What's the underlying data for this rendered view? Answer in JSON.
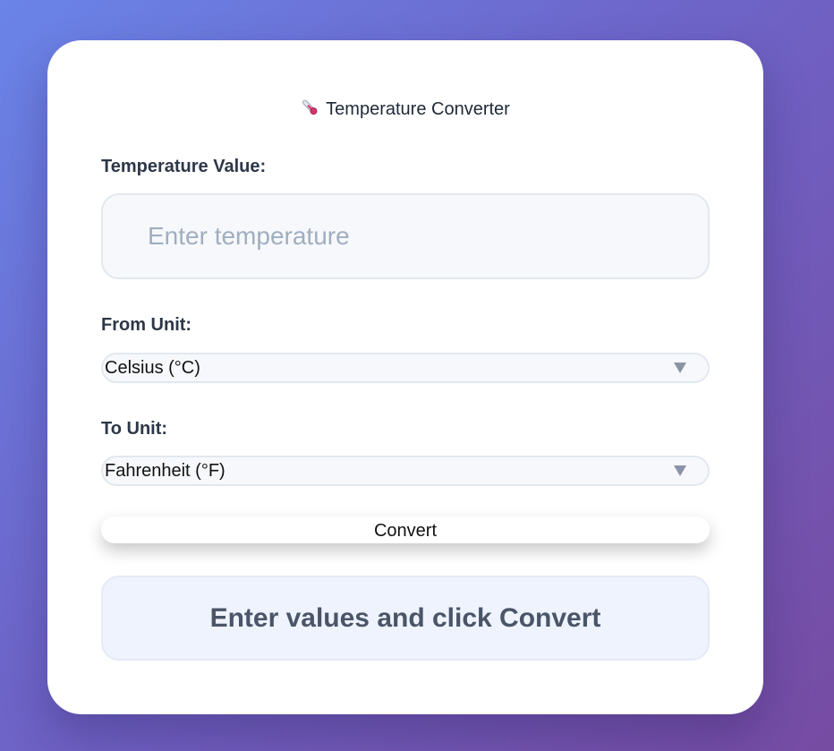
{
  "app": {
    "title": "Temperature Converter",
    "title_icon": "thermometer-icon"
  },
  "form": {
    "value_label": "Temperature Value:",
    "value_placeholder": "Enter temperature",
    "value": "",
    "from_label": "From Unit:",
    "from_selected": "Celsius (°C)",
    "to_label": "To Unit:",
    "to_selected": "Fahrenheit (°F)",
    "convert_label": "Convert"
  },
  "result": {
    "message": "Enter values and click Convert"
  },
  "colors": {
    "background_gradient_start": "#6a84e8",
    "background_gradient_end": "#764ba2",
    "card": "#ffffff",
    "result_bg": "#eef3fd",
    "label_text": "#2d3748"
  }
}
